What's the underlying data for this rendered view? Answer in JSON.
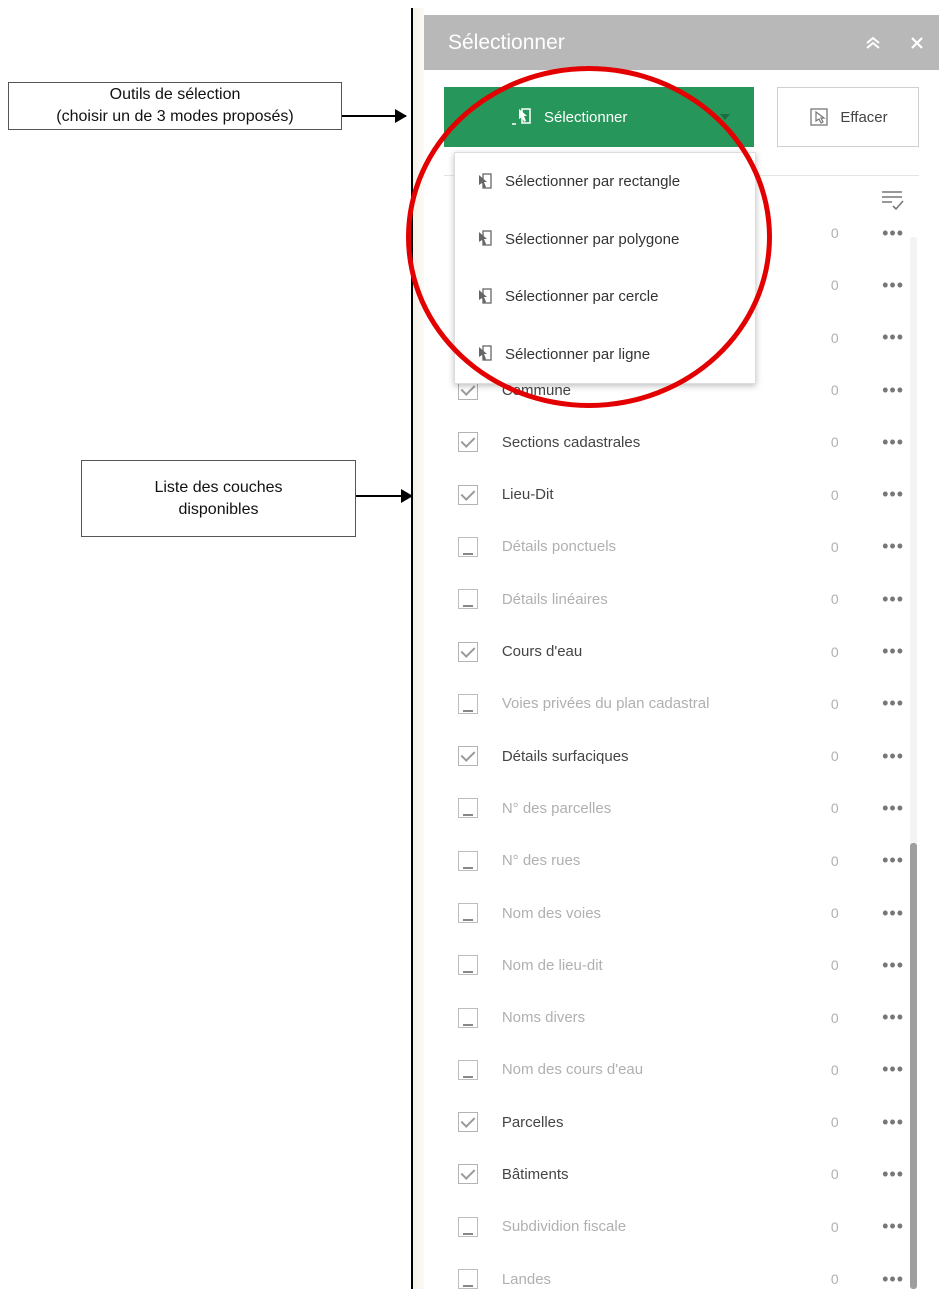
{
  "annotations": {
    "selection_tools": "Outils de sélection\n(choisir un de 3 modes proposés)",
    "layer_list": "Liste des couches\ndisponibles"
  },
  "panel": {
    "title": "Sélectionner",
    "collapse_icon": "double-chevron-up-icon",
    "close_icon": "close-icon"
  },
  "toolbar": {
    "select_label": "Sélectionner",
    "clear_label": "Effacer",
    "select_color": "#27965a"
  },
  "modes": [
    {
      "label": "Sélectionner par rectangle",
      "icon": "select-rectangle-icon"
    },
    {
      "label": "Sélectionner par polygone",
      "icon": "select-polygon-icon"
    },
    {
      "label": "Sélectionner par cercle",
      "icon": "select-circle-icon"
    },
    {
      "label": "Sélectionner par ligne",
      "icon": "select-line-icon"
    }
  ],
  "layers": [
    {
      "name": "",
      "count": "0",
      "checked": true
    },
    {
      "name": "",
      "count": "0",
      "checked": true
    },
    {
      "name": "",
      "count": "0",
      "checked": true
    },
    {
      "name": "Commune",
      "count": "0",
      "checked": true
    },
    {
      "name": "Sections cadastrales",
      "count": "0",
      "checked": true
    },
    {
      "name": "Lieu-Dit",
      "count": "0",
      "checked": true
    },
    {
      "name": "Détails ponctuels",
      "count": "0",
      "checked": false
    },
    {
      "name": "Détails linéaires",
      "count": "0",
      "checked": false
    },
    {
      "name": "Cours d'eau",
      "count": "0",
      "checked": true
    },
    {
      "name": "Voies privées du plan cadastral",
      "count": "0",
      "checked": false
    },
    {
      "name": "Détails surfaciques",
      "count": "0",
      "checked": true
    },
    {
      "name": "N° des parcelles",
      "count": "0",
      "checked": false
    },
    {
      "name": "N° des rues",
      "count": "0",
      "checked": false
    },
    {
      "name": "Nom des voies",
      "count": "0",
      "checked": false
    },
    {
      "name": "Nom de lieu-dit",
      "count": "0",
      "checked": false
    },
    {
      "name": "Noms divers",
      "count": "0",
      "checked": false
    },
    {
      "name": "Nom des cours d'eau",
      "count": "0",
      "checked": false
    },
    {
      "name": "Parcelles",
      "count": "0",
      "checked": true
    },
    {
      "name": "Bâtiments",
      "count": "0",
      "checked": true
    },
    {
      "name": "Subdividion fiscale",
      "count": "0",
      "checked": false
    },
    {
      "name": "Landes",
      "count": "0",
      "checked": false
    }
  ],
  "more_label": "•••",
  "highlight_color": "#e30000"
}
